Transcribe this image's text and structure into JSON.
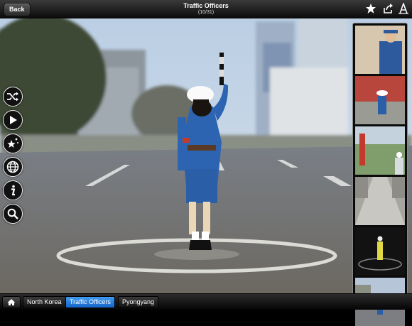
{
  "header": {
    "back_label": "Back",
    "title": "Traffic Officers",
    "counter": "(10/31)"
  },
  "header_actions": [
    {
      "icon": "star-icon"
    },
    {
      "icon": "share-icon"
    },
    {
      "icon": "font-size-icon"
    }
  ],
  "side_tools": [
    {
      "icon": "shuffle-icon"
    },
    {
      "icon": "play-icon"
    },
    {
      "icon": "magic-wand-icon"
    },
    {
      "icon": "globe-icon"
    },
    {
      "icon": "info-icon"
    },
    {
      "icon": "zoom-icon"
    }
  ],
  "thumbnails": 6,
  "breadcrumb": {
    "home_icon": "home-icon",
    "items": [
      "North Korea",
      "Traffic Officers",
      "Pyongyang"
    ],
    "active_index": 1
  },
  "colors": {
    "accent": "#1f7fe0",
    "uniform": "#2a62b0"
  }
}
